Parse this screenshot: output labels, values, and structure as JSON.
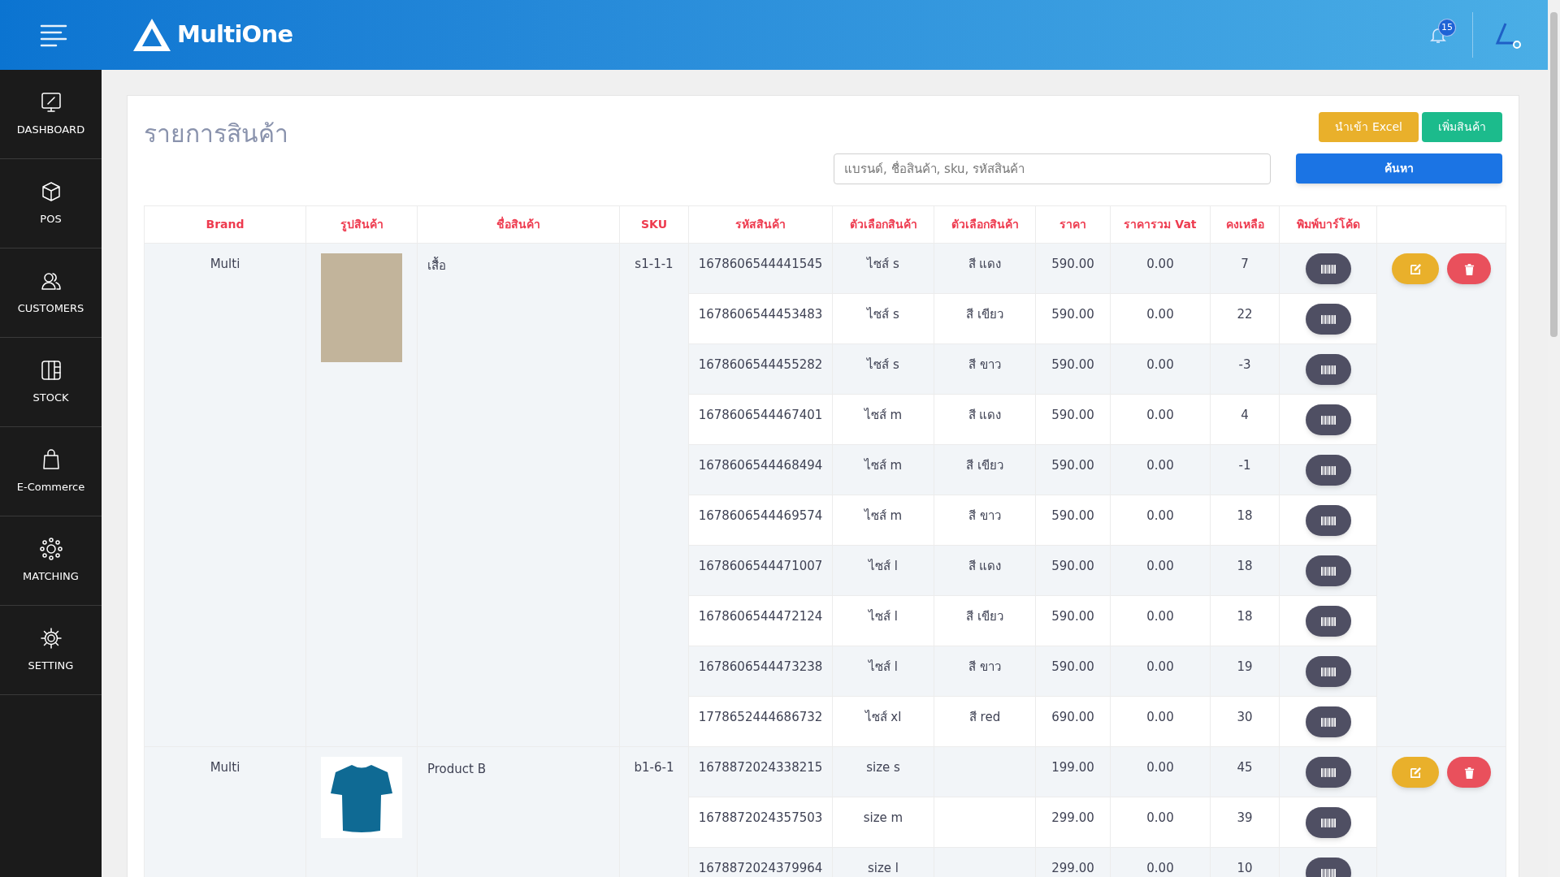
{
  "header": {
    "brand": "MultiOne",
    "notification_count": "15"
  },
  "sidebar": {
    "items": [
      {
        "label": "DASHBOARD"
      },
      {
        "label": "POS"
      },
      {
        "label": "CUSTOMERS"
      },
      {
        "label": "STOCK"
      },
      {
        "label": "E-Commerce"
      },
      {
        "label": "MATCHING"
      },
      {
        "label": "SETTING"
      }
    ]
  },
  "page": {
    "title": "รายการสินค้า",
    "buttons": [
      {
        "label": "นำเข้า Excel",
        "kind": "import"
      },
      {
        "label": "เพิ่มสินค้า",
        "kind": "add"
      }
    ],
    "search": {
      "placeholder": "แบรนด์, ชื่อสินค้า, sku, รหัสสินค้า",
      "button": "ค้นหา"
    }
  },
  "table": {
    "columns": [
      "Brand",
      "รูปสินค้า",
      "ชื่อสินค้า",
      "SKU",
      "รหัสสินค้า",
      "ตัวเลือกสินค้า",
      "ตัวเลือกสินค้า",
      "ราคา",
      "ราคารวม Vat",
      "คงเหลือ",
      "พิมพ์บาร์โค้ด"
    ],
    "products": [
      {
        "brand": "Multi",
        "kind": "mascot",
        "name": "เสื้อ",
        "sku": "s1-1-1",
        "variants": [
          {
            "code": "1678606544441545",
            "option_1": "ไซส์ s",
            "option_2": "สี แดง",
            "price": "590.00",
            "vat_price": "0.00",
            "stock": "7"
          },
          {
            "code": "1678606544453483",
            "option_1": "ไซส์ s",
            "option_2": "สี เขียว",
            "price": "590.00",
            "vat_price": "0.00",
            "stock": "22"
          },
          {
            "code": "1678606544455282",
            "option_1": "ไซส์ s",
            "option_2": "สี ขาว",
            "price": "590.00",
            "vat_price": "0.00",
            "stock": "-3"
          },
          {
            "code": "1678606544467401",
            "option_1": "ไซส์ m",
            "option_2": "สี แดง",
            "price": "590.00",
            "vat_price": "0.00",
            "stock": "4"
          },
          {
            "code": "1678606544468494",
            "option_1": "ไซส์ m",
            "option_2": "สี เขียว",
            "price": "590.00",
            "vat_price": "0.00",
            "stock": "-1"
          },
          {
            "code": "1678606544469574",
            "option_1": "ไซส์ m",
            "option_2": "สี ขาว",
            "price": "590.00",
            "vat_price": "0.00",
            "stock": "18"
          },
          {
            "code": "1678606544471007",
            "option_1": "ไซส์ l",
            "option_2": "สี แดง",
            "price": "590.00",
            "vat_price": "0.00",
            "stock": "18"
          },
          {
            "code": "1678606544472124",
            "option_1": "ไซส์ l",
            "option_2": "สี เขียว",
            "price": "590.00",
            "vat_price": "0.00",
            "stock": "18"
          },
          {
            "code": "1678606544473238",
            "option_1": "ไซส์ l",
            "option_2": "สี ขาว",
            "price": "590.00",
            "vat_price": "0.00",
            "stock": "19"
          },
          {
            "code": "1778652444686732",
            "option_1": "ไซส์ xl",
            "option_2": "สี red",
            "price": "690.00",
            "vat_price": "0.00",
            "stock": "30"
          }
        ]
      },
      {
        "brand": "Multi",
        "kind": "shirt",
        "name": "Product B",
        "sku": "b1-6-1",
        "variants": [
          {
            "code": "1678872024338215",
            "option_1": "size s",
            "price": "199.00",
            "vat_price": "0.00",
            "stock": "45"
          },
          {
            "code": "1678872024357503",
            "option_1": "size m",
            "price": "299.00",
            "vat_price": "0.00",
            "stock": "39"
          },
          {
            "code": "1678872024379964",
            "option_1": "size l",
            "price": "299.00",
            "vat_price": "0.00",
            "stock": "10"
          }
        ]
      }
    ]
  }
}
